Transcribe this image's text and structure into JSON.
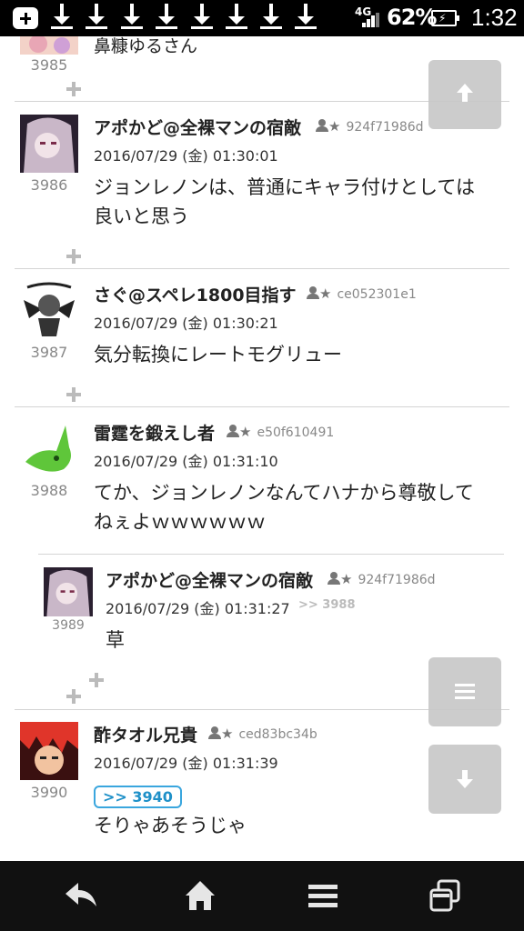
{
  "status_bar": {
    "network": "4G",
    "battery_percent": "62%",
    "battery_level": 0.62,
    "time": "1:32",
    "download_icons": 8
  },
  "posts": [
    {
      "no": "3985",
      "name": "鼻糠ゆるさん",
      "partial": true
    },
    {
      "no": "3986",
      "name": "アポかど@全裸マンの宿敵",
      "id": "924f71986d",
      "date": "2016/07/29 (金) 01:30:01",
      "body": [
        "ジョンレノンは、普通にキャラ付けとしては",
        "良いと思う"
      ]
    },
    {
      "no": "3987",
      "name": "さぐ@スペレ1800目指す",
      "id": "ce052301e1",
      "date": "2016/07/29 (金) 01:30:21",
      "body": [
        "気分転換にレートモグリュー"
      ]
    },
    {
      "no": "3988",
      "name": "雷霆を鍛えし者",
      "id": "e50f610491",
      "date": "2016/07/29 (金) 01:31:10",
      "body": [
        "てか、ジョンレノンなんてハナから尊敬して",
        "ねぇよｗｗｗｗｗｗ"
      ]
    },
    {
      "no": "3989",
      "name": "アポかど@全裸マンの宿敵",
      "id": "924f71986d",
      "date": "2016/07/29 (金) 01:31:27",
      "reply_to": ">> 3988",
      "body": [
        "草"
      ],
      "nested": true
    },
    {
      "no": "3990",
      "name": "酢タオル兄貴",
      "id": "ced83bc34b",
      "date": "2016/07/29 (金) 01:31:39",
      "anchor": ">> 3940",
      "body": [
        "そりゃあそうじゃ"
      ]
    }
  ],
  "floating_buttons": {
    "scroll_top": "arrow-up-icon",
    "menu": "menu-icon",
    "scroll_bottom": "arrow-down-icon"
  },
  "colors": {
    "anchor_border": "#3aa6de",
    "fab": "#c8c8c8",
    "status_bar": "#000000",
    "nav_bar": "#111111"
  },
  "nav_bar": [
    "back-icon",
    "home-icon",
    "menu-icon",
    "recent-apps-icon"
  ]
}
